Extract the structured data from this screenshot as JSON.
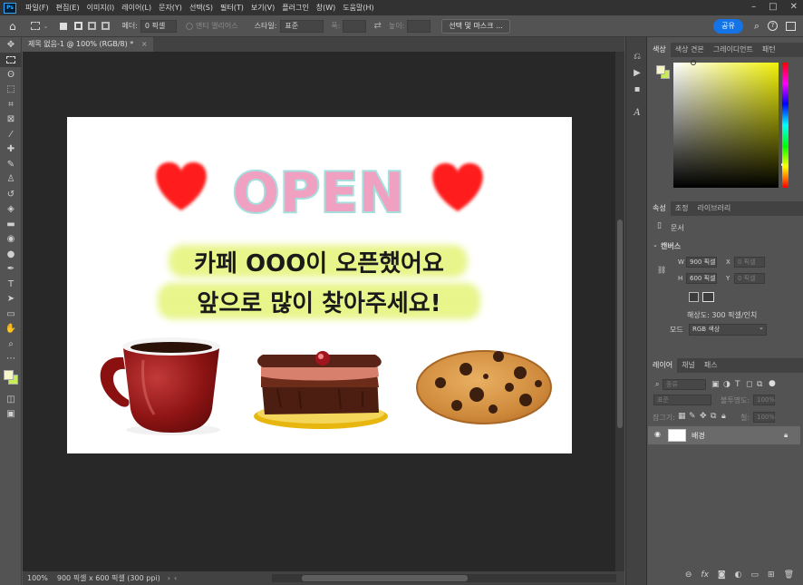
{
  "app": {
    "logo": "Ps",
    "menus": [
      "파일(F)",
      "편집(E)",
      "이미지(I)",
      "레이어(L)",
      "문자(Y)",
      "선택(S)",
      "필터(T)",
      "보기(V)",
      "플러그인",
      "창(W)",
      "도움말(H)"
    ],
    "window_controls": [
      "–",
      "□",
      "✕"
    ]
  },
  "options_bar": {
    "feather_label": "페더:",
    "feather_value": "0 픽셀",
    "antialias_label": "앤티 앨리어스",
    "style_label": "스타일:",
    "style_value": "표준",
    "width_label": "폭:",
    "height_label": "높이:",
    "select_mask_label": "선택 및 마스크 ...",
    "share_label": "공유"
  },
  "document": {
    "tab_title": "제목 없음-1 @ 100% (RGB/8) *",
    "tab_close": "×",
    "zoom": "100%",
    "status": "900 픽셀 x 600 픽셀 (300 ppi)"
  },
  "artwork": {
    "headline": "OPEN",
    "line1": "카페 OOO이 오픈했어요",
    "line2": "앞으로 많이 찾아주세요!",
    "heart_color": "#ff1a1a",
    "open_fill": "#f0a0c0",
    "open_outline": "#a6dede",
    "highlight": "#e7f58a"
  },
  "panels": {
    "color_tabs": [
      "색상",
      "색상 견본",
      "그레이디언트",
      "패턴"
    ],
    "properties_tabs": [
      "속성",
      "조정",
      "라이브러리"
    ],
    "properties": {
      "doc_label": "문서",
      "canvas_label": "캔버스",
      "w_label": "W",
      "w_value": "900 픽셀",
      "h_label": "H",
      "h_value": "600 픽셀",
      "x_label": "X",
      "x_value": "0 픽셀",
      "y_label": "Y",
      "y_value": "0 픽셀",
      "resolution": "해상도: 300 픽셀/인치",
      "mode_label": "모드",
      "mode_value": "RGB 색상"
    },
    "layers_tabs": [
      "레이어",
      "채널",
      "패스"
    ],
    "layers": {
      "search_placeholder": "종류",
      "blend_mode": "표준",
      "opacity_label": "불투명도:",
      "opacity_value": "100%",
      "lock_label": "잠그기:",
      "fill_label": "칠:",
      "fill_value": "100%",
      "rows": [
        {
          "name": "배경"
        }
      ]
    }
  },
  "colors": {
    "foreground": "#f5f5c8",
    "background": "#c7ec5a"
  }
}
